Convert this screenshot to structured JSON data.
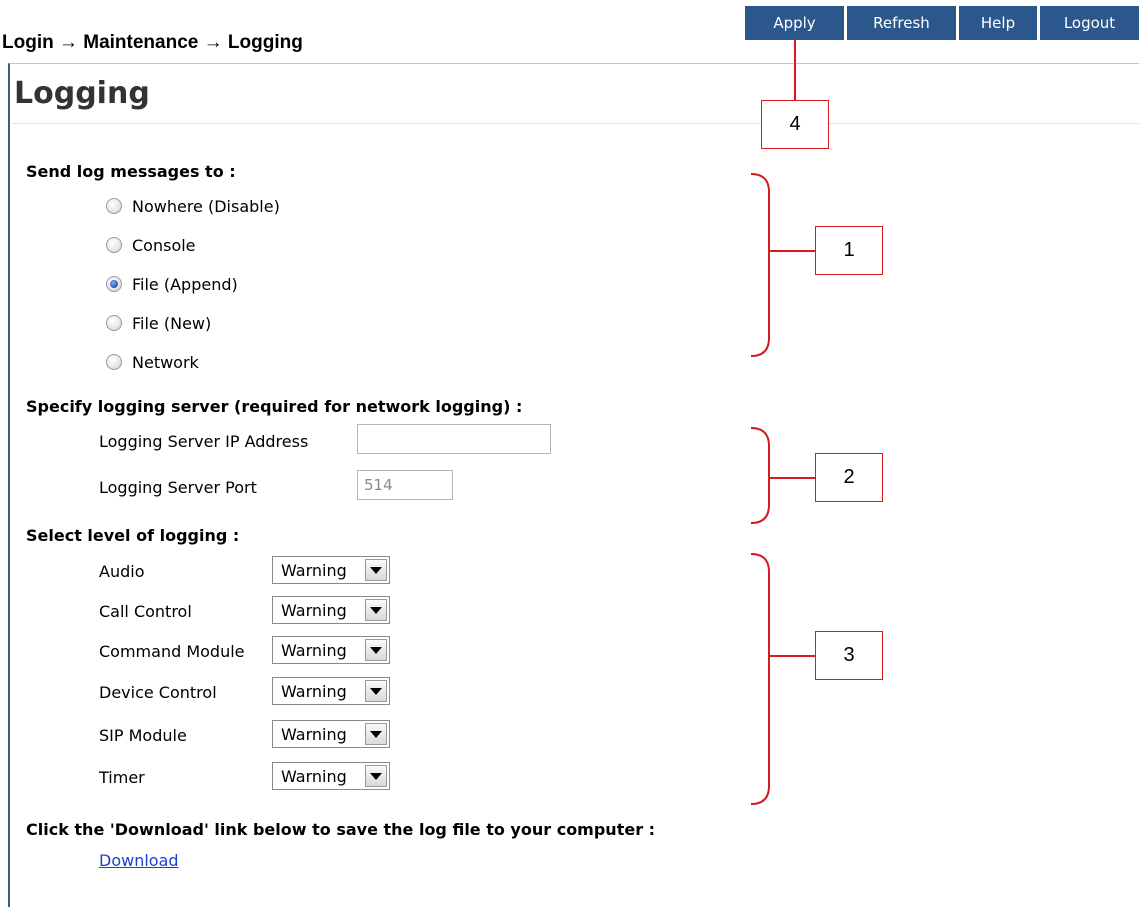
{
  "breadcrumb": "Login → Maintenance → Logging",
  "toolbar": {
    "apply": "Apply",
    "refresh": "Refresh",
    "help": "Help",
    "logout": "Logout"
  },
  "page_title": "Logging",
  "send_log": {
    "heading": "Send log messages to :",
    "options": [
      {
        "label": "Nowhere (Disable)",
        "selected": false
      },
      {
        "label": "Console",
        "selected": false
      },
      {
        "label": "File (Append)",
        "selected": true
      },
      {
        "label": "File (New)",
        "selected": false
      },
      {
        "label": "Network",
        "selected": false
      }
    ]
  },
  "server": {
    "heading": "Specify logging server (required for network logging) :",
    "ip_label": "Logging Server IP Address",
    "ip_value": "",
    "port_label": "Logging Server Port",
    "port_placeholder": "514"
  },
  "levels": {
    "heading": "Select level of logging :",
    "items": [
      {
        "label": "Audio",
        "value": "Warning"
      },
      {
        "label": "Call Control",
        "value": "Warning"
      },
      {
        "label": "Command Module",
        "value": "Warning"
      },
      {
        "label": "Device Control",
        "value": "Warning"
      },
      {
        "label": "SIP Module",
        "value": "Warning"
      },
      {
        "label": "Timer",
        "value": "Warning"
      }
    ]
  },
  "download": {
    "heading": "Click the 'Download' link below to save the log file to your computer :",
    "link": "Download"
  },
  "callouts": {
    "c1": "1",
    "c2": "2",
    "c3": "3",
    "c4": "4"
  },
  "colors": {
    "toolbar_bg": "#2c578c",
    "annotation": "#d71921",
    "link": "#1a3fd6",
    "radio_selected": "#1f57b4"
  }
}
